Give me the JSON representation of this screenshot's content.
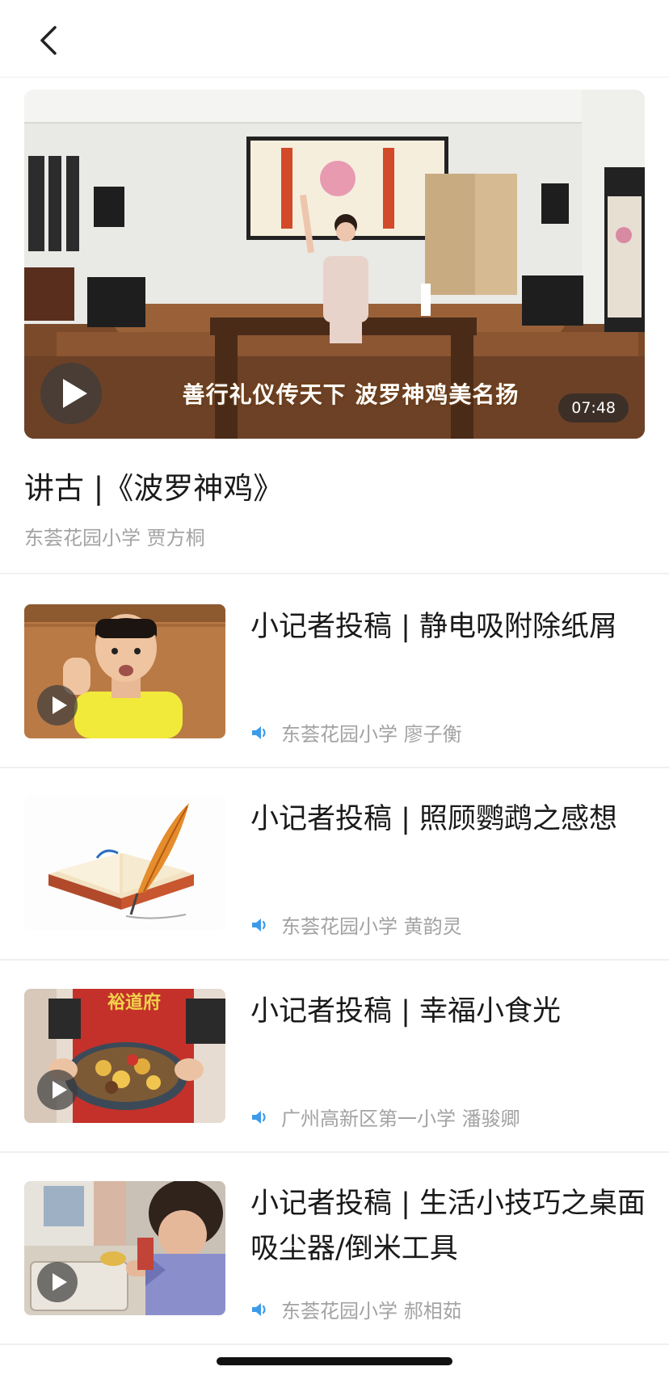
{
  "nav": {
    "back_icon": "chevron-left-icon"
  },
  "featured": {
    "caption": "善行礼仪传天下 波罗神鸡美名扬",
    "duration": "07:48",
    "title": "讲古 |《波罗神鸡》",
    "author": "东荟花园小学 贾方桐"
  },
  "items": [
    {
      "title": "小记者投稿 | 静电吸附除纸屑",
      "author": "东荟花园小学 廖子衡",
      "has_play": true
    },
    {
      "title": "小记者投稿 | 照顾鹦鹉之感想",
      "author": "东荟花园小学 黄韵灵",
      "has_play": false
    },
    {
      "title": "小记者投稿 | 幸福小食光",
      "author": "广州高新区第一小学 潘骏卿",
      "has_play": true
    },
    {
      "title": "小记者投稿 | 生活小技巧之桌面吸尘器/倒米工具",
      "author": "东荟花园小学 郝相茹",
      "has_play": true
    }
  ],
  "colors": {
    "accent_audio": "#3d9be9",
    "meta_text": "#a3a3a3"
  }
}
